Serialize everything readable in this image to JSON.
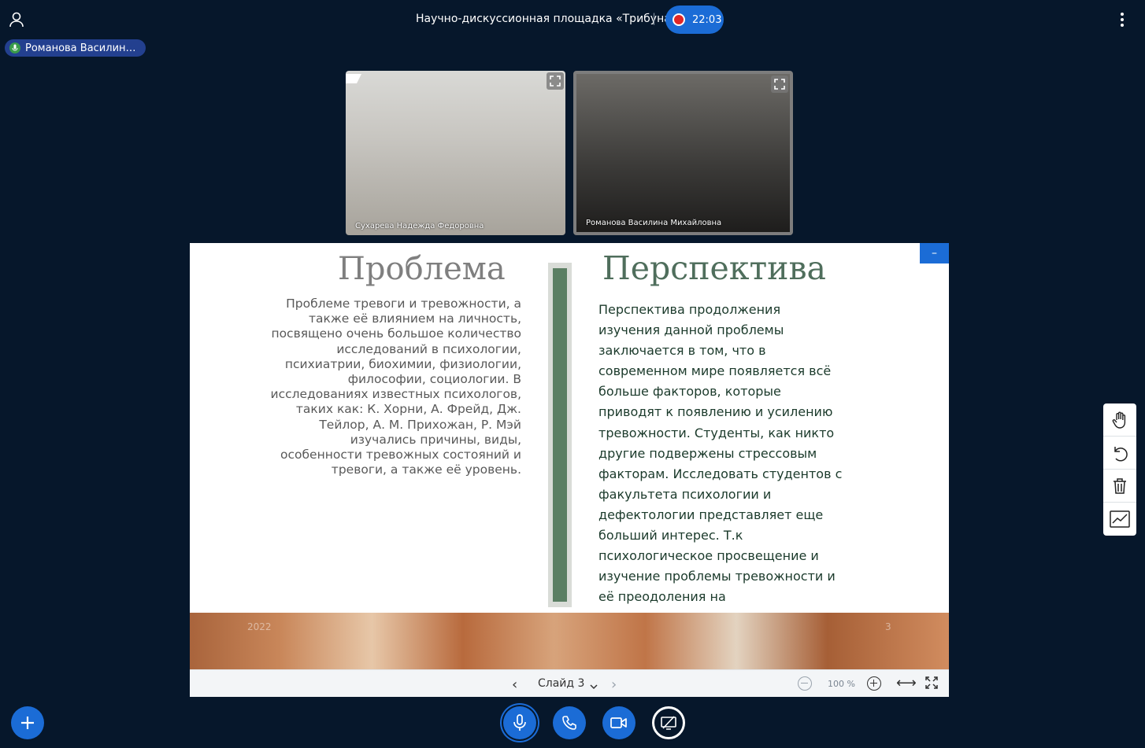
{
  "header": {
    "title": "Научно-дискуссионная площадка «Трибуна»",
    "separator": "|",
    "recording_time": "22:03",
    "icons": [
      "user-icon",
      "record-icon",
      "more-vertical-icon"
    ]
  },
  "speaker": {
    "name": "Романова Василин…"
  },
  "videos": [
    {
      "name": "Сухарева Надежда Федоровна"
    },
    {
      "name": "Романова Василина Михайловна"
    }
  ],
  "slide": {
    "minimize_label": "–",
    "left_heading": "Проблема",
    "left_text": "Проблеме тревоги и тревожности, а также её влиянием на личность, посвящено очень большое количество исследований в психологии, психиатрии, биохимии, физиологии, философии, социологии. В исследованиях известных психологов, таких как: К. Хорни, А. Фрейд, Дж. Тейлор, А. М. Прихожан, Р. Мэй изучались причины, виды, особенности тревожных состояний и тревоги, а также её уровень.",
    "right_heading": "Перспектива",
    "right_text": "Перспектива продолжения изучения данной проблемы заключается в том, что в современном мире появляется всё больше факторов, которые приводят к появлению и усилению тревожности. Студенты, как никто другие подвержены стрессовым факторам. Исследовать студентов с факультета психологии и дефектологии представляет еще больший интерес. Т.к психологическое просвещение и изучение проблемы тревожности и её преодоления на",
    "footer_year": "2022",
    "footer_num": "3",
    "accent_color": "#5b7f63"
  },
  "slide_bar": {
    "prev": "‹",
    "label": "Слайд 3",
    "next": "›",
    "zoom": "100 %",
    "fit_width": "⟷"
  },
  "toolbar_icons": [
    "hand-icon",
    "undo-icon",
    "trash-icon",
    "chart-icon"
  ],
  "controls": [
    "add-icon",
    "microphone-icon",
    "phone-icon",
    "camera-icon",
    "screen-share-off-icon"
  ],
  "colors": {
    "background": "#06172b",
    "primary": "#1b6cd6",
    "speaker_pill": "#23408f"
  }
}
